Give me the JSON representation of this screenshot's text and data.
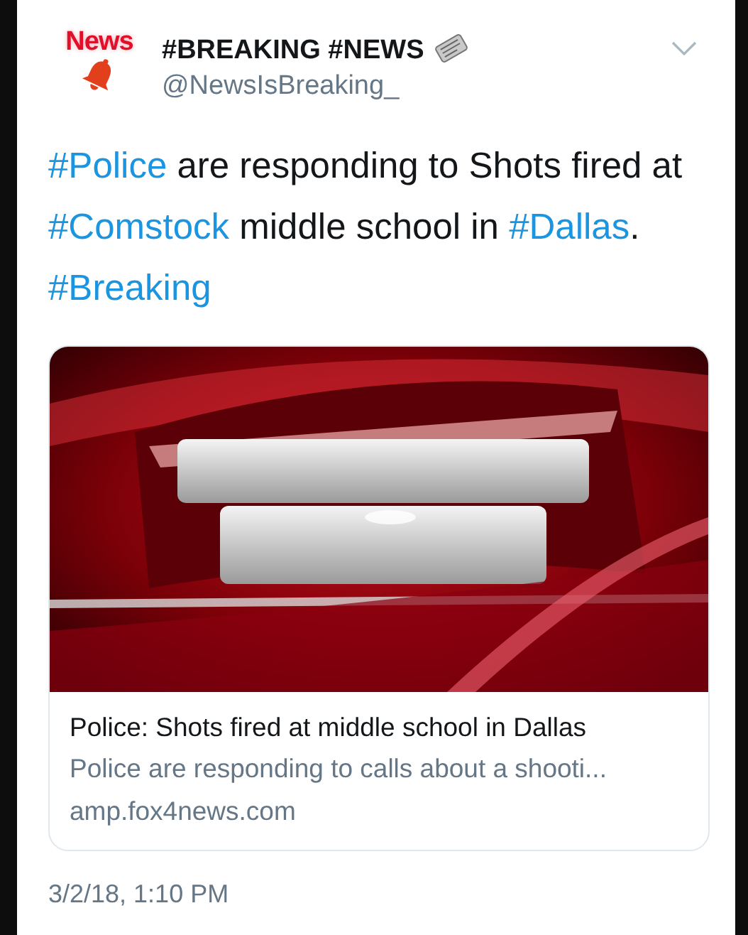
{
  "tweet": {
    "avatar": {
      "logo_text": "News"
    },
    "display_name": "#BREAKING #NEWS",
    "handle": "@NewsIsBreaking_",
    "text": [
      {
        "kind": "hashtag",
        "text": "#Police"
      },
      {
        "kind": "plain",
        "text": " are responding to Shots fired at "
      },
      {
        "kind": "hashtag",
        "text": "#Comstock"
      },
      {
        "kind": "plain",
        "text": " middle school in "
      },
      {
        "kind": "hashtag",
        "text": "#Dallas"
      },
      {
        "kind": "plain",
        "text": ". "
      },
      {
        "kind": "hashtag",
        "text": "#Breaking"
      }
    ],
    "card": {
      "title": "Police: Shots fired at middle school in Dallas",
      "description": "Police are responding to calls about a shooti...",
      "domain": "amp.fox4news.com"
    },
    "timestamp": "3/2/18, 1:10 PM"
  }
}
